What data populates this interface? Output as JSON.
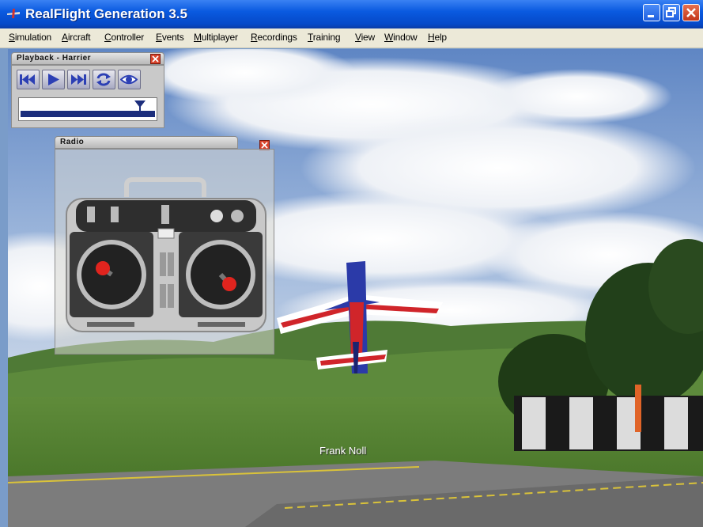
{
  "window": {
    "title": "RealFlight Generation 3.5",
    "controls": [
      "minimize",
      "restore",
      "close"
    ]
  },
  "menu": [
    {
      "label": "Simulation",
      "underline": 0
    },
    {
      "label": "Aircraft",
      "underline": 0
    },
    {
      "label": "Controller",
      "underline": 0
    },
    {
      "label": "Events",
      "underline": 0
    },
    {
      "label": "Multiplayer",
      "underline": 0
    },
    {
      "label": "Recordings",
      "underline": 0
    },
    {
      "label": "Training",
      "underline": 0
    },
    {
      "label": "View",
      "underline": 0
    },
    {
      "label": "Window",
      "underline": 0
    },
    {
      "label": "Help",
      "underline": 0
    }
  ],
  "playback": {
    "title": "Playback - Harrier",
    "buttons": [
      "rewind-icon",
      "play-icon",
      "fast-forward-icon",
      "loop-icon",
      "eye-icon"
    ],
    "position": 0.92
  },
  "radio": {
    "title": "Radio"
  },
  "scene": {
    "pilot_label": "Frank Noll"
  },
  "colors": {
    "titlebar": "#0a5ae0",
    "menubar": "#ece9d8",
    "panel_button": "#2c3fb4",
    "slider_fill": "#1c2e7c",
    "close_red": "#d9442c"
  }
}
